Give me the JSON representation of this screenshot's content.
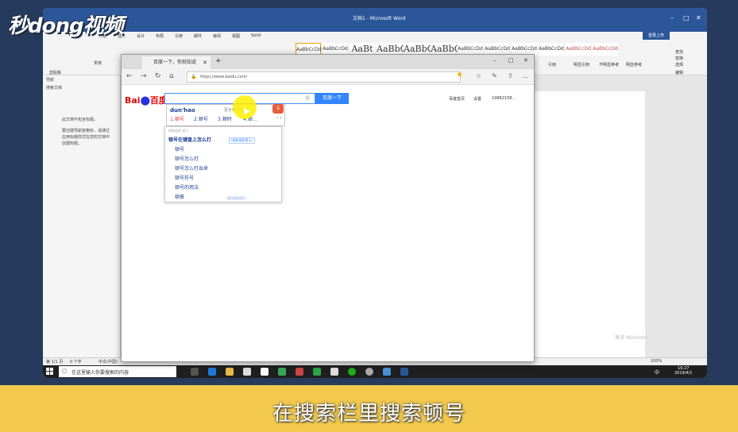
{
  "logo": {
    "text": "秒dong视频"
  },
  "subtitle": "在搜索栏里搜索顿号",
  "word": {
    "title": "文档1 - Microsoft Word",
    "tabs": [
      "开始",
      "插入",
      "设计",
      "布局",
      "引用",
      "邮件",
      "审阅",
      "视图",
      "Solid"
    ],
    "share_label": "登录上传",
    "font_name": "宋体",
    "font_size": "72",
    "style_samples": [
      "AaBbCcDd",
      "AaBbCcDd",
      "AaBt",
      "AaBbC",
      "AaBbC",
      "AaBbC",
      "AaBbCcDd",
      "AaBbCcDd",
      "AaBbCcDd",
      "AaBbCcDd",
      "AaBbCcDd",
      "AaBbCcDd"
    ],
    "style_labels": [
      "引用",
      "明显引用",
      "不明显参考",
      "明显参考"
    ],
    "edit_labels": [
      "查找",
      "替换",
      "选择"
    ],
    "group_labels": [
      "剪贴板",
      "编辑"
    ],
    "nav_pane": {
      "title": "导航",
      "search_placeholder": "搜索文档",
      "text_1": "此文档不包含标题。",
      "text_2": "要创建导航窗格标，请通过应用标题样式在您的文档中创建标题。"
    },
    "status": {
      "page": "第 1/1 页",
      "words": "0 个字",
      "lang": "中文(中国)",
      "zoom": "100%"
    },
    "watermark": "激活 Windows"
  },
  "taskbar": {
    "search_placeholder": "在这里输入你要搜索的内容",
    "time": "16:27",
    "date": "2019/4/1",
    "lang": "中"
  },
  "browser": {
    "tab_title": "百度一下，你就知道",
    "url": "https://www.baidu.com/",
    "top_links": [
      "百度首页",
      "设置",
      "19862158..."
    ],
    "search_button": "百度一下",
    "ime": {
      "pinyin": "dun'hao",
      "hint": "更多特殊符号",
      "candidates": [
        "1.顿号",
        "2.顿号",
        "3.顿时",
        "4.顿..."
      ]
    },
    "suggestions": {
      "header": "搜狗搜索 提示",
      "items": [
        "顿号在键盘上怎么打",
        "顿号",
        "顿号怎么打",
        "顿号怎么打出来",
        "顿号符号",
        "顿号的用法",
        "顿豪"
      ],
      "badge": "(搜狗搜索提示)",
      "footer": "使用搜索提示"
    }
  }
}
